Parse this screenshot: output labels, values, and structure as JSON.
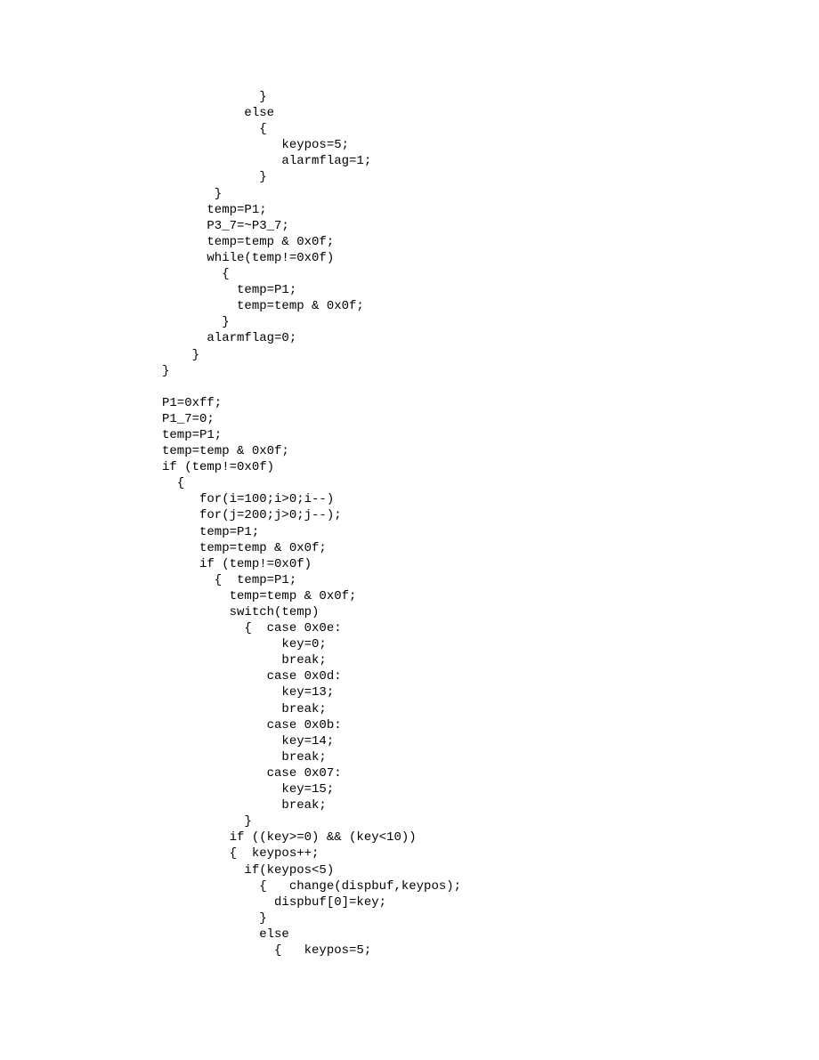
{
  "code": {
    "lines": [
      "             }",
      "           else",
      "             {",
      "                keypos=5;",
      "                alarmflag=1;",
      "             }",
      "       }",
      "      temp=P1;",
      "      P3_7=~P3_7;",
      "      temp=temp & 0x0f;",
      "      while(temp!=0x0f)",
      "        {",
      "          temp=P1;",
      "          temp=temp & 0x0f;",
      "        }",
      "      alarmflag=0;",
      "    }",
      "}",
      "",
      "P1=0xff;",
      "P1_7=0;",
      "temp=P1;",
      "temp=temp & 0x0f;",
      "if (temp!=0x0f)",
      "  {",
      "     for(i=100;i>0;i--)",
      "     for(j=200;j>0;j--);",
      "     temp=P1;",
      "     temp=temp & 0x0f;",
      "     if (temp!=0x0f)",
      "       {  temp=P1;",
      "         temp=temp & 0x0f;",
      "         switch(temp)",
      "           {  case 0x0e:",
      "                key=0;",
      "                break;",
      "              case 0x0d:",
      "                key=13;",
      "                break;",
      "              case 0x0b:",
      "                key=14;",
      "                break;",
      "              case 0x07:",
      "                key=15;",
      "                break;",
      "           }",
      "         if ((key>=0) && (key<10))",
      "         {  keypos++;",
      "           if(keypos<5)",
      "             {   change(dispbuf,keypos);",
      "               dispbuf[0]=key;",
      "             }",
      "             else",
      "               {   keypos=5;"
    ]
  }
}
